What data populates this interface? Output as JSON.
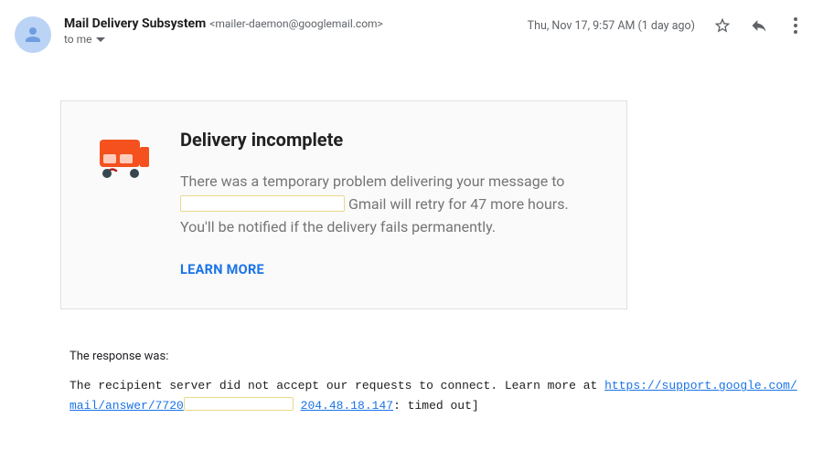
{
  "header": {
    "sender_name": "Mail Delivery Subsystem",
    "sender_email": "<mailer-daemon@googlemail.com>",
    "recipient": "to me",
    "timestamp": "Thu, Nov 17, 9:57 AM (1 day ago)"
  },
  "card": {
    "title": "Delivery incomplete",
    "body_part1": "There was a temporary problem delivering your message to ",
    "body_part2": "Gmail will retry for 47 more hours. You'll be notified if the delivery fails permanently.",
    "learn_more": "LEARN MORE"
  },
  "response": {
    "label": "The response was:",
    "line1_a": "The recipient server did not accept our requests to connect. Learn more at ",
    "link1": "https://support.google.com/",
    "link2_prefix": "mail/answer/7720",
    "ip_link": "204.48.18.147",
    "line2_tail": ": timed out]"
  }
}
